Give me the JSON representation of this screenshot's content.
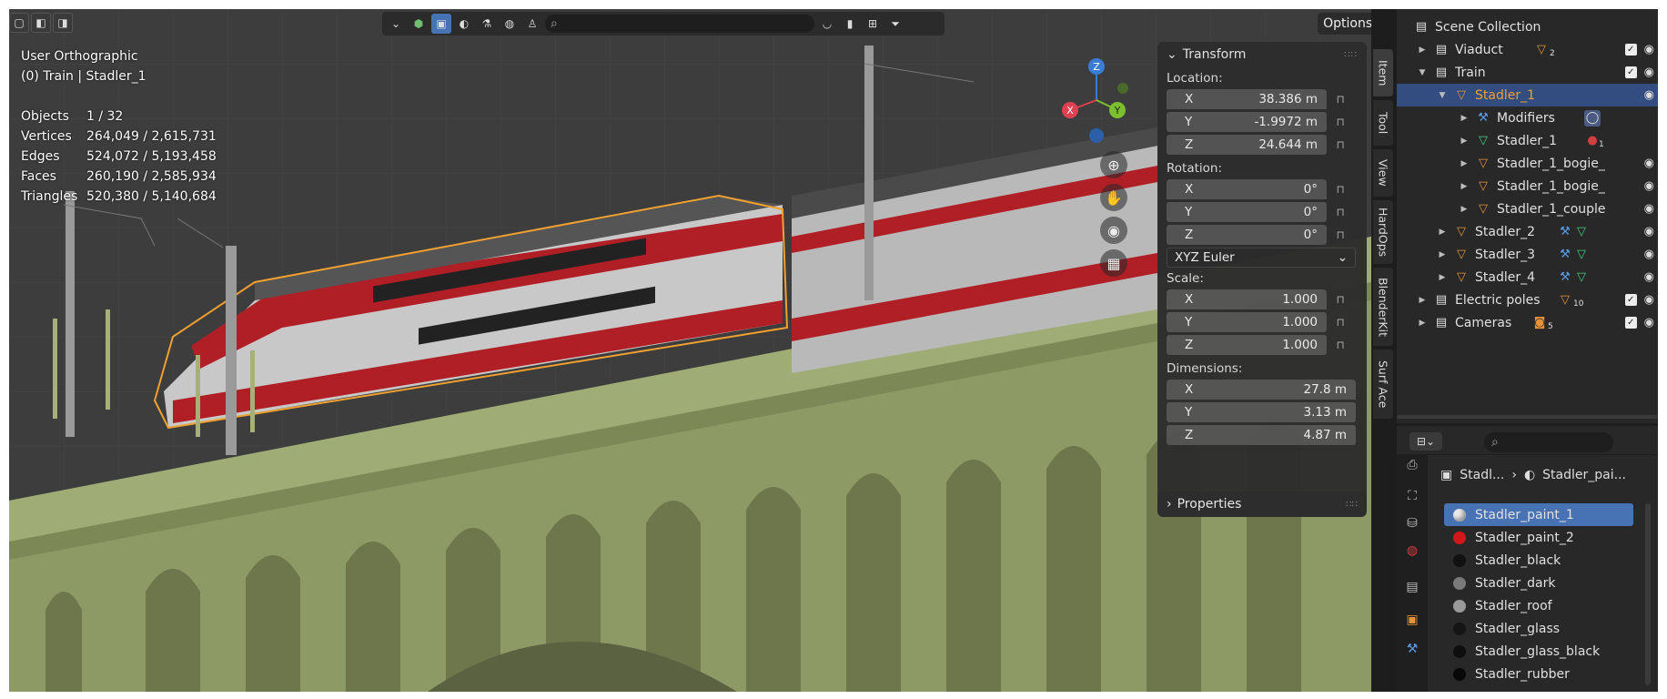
{
  "viewport": {
    "view_name": "User Orthographic",
    "context": "(0) Train | Stadler_1",
    "stats": [
      {
        "label": "Objects",
        "value": "1 / 32"
      },
      {
        "label": "Vertices",
        "value": "264,049 / 2,615,731"
      },
      {
        "label": "Edges",
        "value": "524,072 / 5,193,458"
      },
      {
        "label": "Faces",
        "value": "260,190 / 2,585,934"
      },
      {
        "label": "Triangles",
        "value": "520,380 / 5,140,684"
      }
    ],
    "options_label": "Options",
    "gizmo": {
      "x": "X",
      "y": "Y",
      "z": "Z"
    }
  },
  "transform": {
    "title": "Transform",
    "location_label": "Location:",
    "location": [
      {
        "axis": "X",
        "value": "38.386 m"
      },
      {
        "axis": "Y",
        "value": "-1.9972 m"
      },
      {
        "axis": "Z",
        "value": "24.644 m"
      }
    ],
    "rotation_label": "Rotation:",
    "rotation": [
      {
        "axis": "X",
        "value": "0°"
      },
      {
        "axis": "Y",
        "value": "0°"
      },
      {
        "axis": "Z",
        "value": "0°"
      }
    ],
    "rotation_mode": "XYZ Euler",
    "scale_label": "Scale:",
    "scale": [
      {
        "axis": "X",
        "value": "1.000"
      },
      {
        "axis": "Y",
        "value": "1.000"
      },
      {
        "axis": "Z",
        "value": "1.000"
      }
    ],
    "dimensions_label": "Dimensions:",
    "dimensions": [
      {
        "axis": "X",
        "value": "27.8 m"
      },
      {
        "axis": "Y",
        "value": "3.13 m"
      },
      {
        "axis": "Z",
        "value": "4.87 m"
      }
    ]
  },
  "properties_panel": {
    "title": "Properties"
  },
  "vtabs": [
    "Item",
    "Tool",
    "View",
    "HardOps",
    "BlenderKit",
    "Surf Ace"
  ],
  "outliner": {
    "rows": [
      {
        "name": "Scene Collection",
        "badge": ""
      },
      {
        "name": "Viaduct",
        "badge": "2"
      },
      {
        "name": "Train",
        "badge": ""
      },
      {
        "name": "Stadler_1",
        "badge": ""
      },
      {
        "name": "Modifiers",
        "badge": ""
      },
      {
        "name": "Stadler_1",
        "badge": "1"
      },
      {
        "name": "Stadler_1_bogie_",
        "badge": ""
      },
      {
        "name": "Stadler_1_bogie_",
        "badge": ""
      },
      {
        "name": "Stadler_1_couple",
        "badge": ""
      },
      {
        "name": "Stadler_2",
        "badge": ""
      },
      {
        "name": "Stadler_3",
        "badge": ""
      },
      {
        "name": "Stadler_4",
        "badge": ""
      },
      {
        "name": "Electric poles",
        "badge": "10"
      },
      {
        "name": "Cameras",
        "badge": "5"
      }
    ]
  },
  "properties": {
    "breadcrumb_object": "Stadl...",
    "breadcrumb_material": "Stadler_pai...",
    "materials": [
      {
        "name": "Stadler_paint_1",
        "color": "#e8e8e8"
      },
      {
        "name": "Stadler_paint_2",
        "color": "#d01818"
      },
      {
        "name": "Stadler_black",
        "color": "#111111"
      },
      {
        "name": "Stadler_dark",
        "color": "#7a7a7a"
      },
      {
        "name": "Stadler_roof",
        "color": "#9a9a9a"
      },
      {
        "name": "Stadler_glass",
        "color": "#151515"
      },
      {
        "name": "Stadler_glass_black",
        "color": "#0e0e0e"
      },
      {
        "name": "Stadler_rubber",
        "color": "#080808"
      }
    ]
  }
}
